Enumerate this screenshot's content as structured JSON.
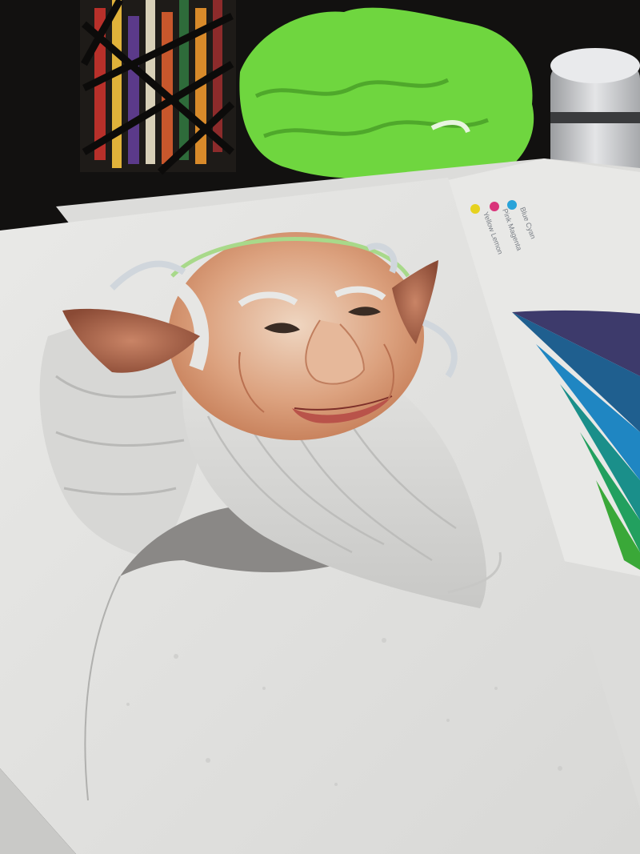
{
  "scene": {
    "subject": "colored pencil drawing of a smiling elf with pointed ears and a flowing white beard",
    "palette": {
      "background": "#121110",
      "paper": "#e6e6e4",
      "skin": "#dca27f",
      "beard": "#d4d4d2",
      "cloth": "#6fd63f"
    }
  },
  "color_chart": {
    "legend": [
      {
        "label": "Blue Cyan",
        "color": "#29a3d9"
      },
      {
        "label": "Pink Magenta",
        "color": "#d9337a"
      },
      {
        "label": "Yellow Lemon",
        "color": "#e6d21f"
      }
    ],
    "wheel_colors": [
      "#3d3a6b",
      "#1f5f8f",
      "#1f86c2",
      "#1a8f8a",
      "#22a05f",
      "#3aa838"
    ]
  }
}
